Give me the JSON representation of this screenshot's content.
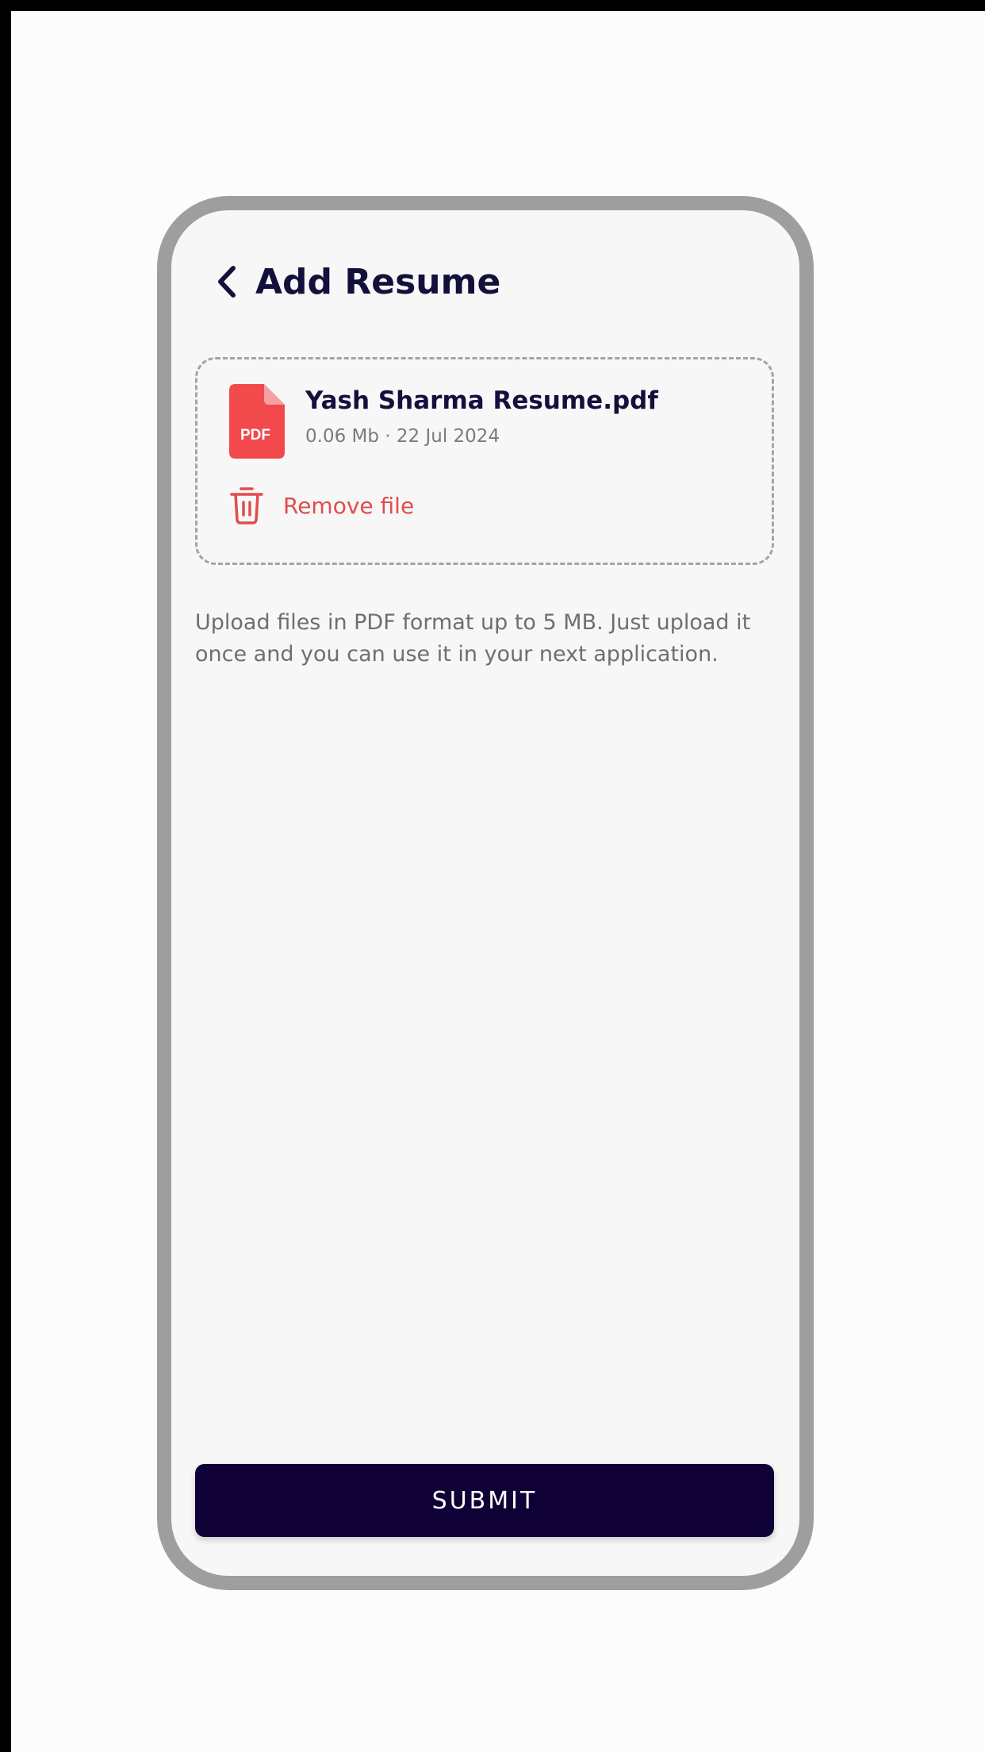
{
  "header": {
    "title": "Add Resume",
    "back_icon": "chevron-left-icon"
  },
  "file": {
    "name": "Yash Sharma Resume.pdf",
    "meta": "0.06 Mb · 22 Jul 2024",
    "type_badge": "PDF",
    "icon": "pdf-file-icon",
    "icon_color": "#f2494c"
  },
  "remove": {
    "label": "Remove file",
    "icon": "trash-icon",
    "color": "#e04d4f"
  },
  "helper_text": "Upload files in PDF format up to 5 MB. Just upload it once and you can use it in your next application.",
  "submit": {
    "label": "SUBMIT",
    "color": "#0f0136"
  }
}
